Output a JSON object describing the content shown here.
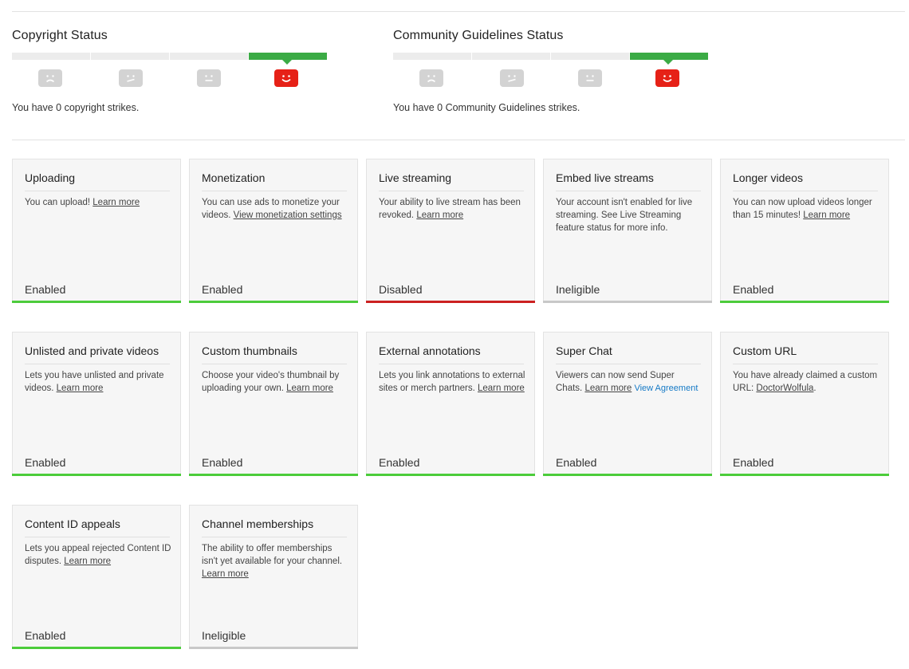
{
  "copyright": {
    "title": "Copyright Status",
    "message": "You have 0 copyright strikes.",
    "strike_levels": 4,
    "current_level": 4
  },
  "community": {
    "title": "Community Guidelines Status",
    "message": "You have 0 Community Guidelines strikes.",
    "strike_levels": 4,
    "current_level": 4
  },
  "colors": {
    "enabled": "#4ccc3b",
    "disabled": "#cc2121",
    "ineligible": "#c8c8c8",
    "active_face": "#e62117",
    "active_bar": "#3bab45"
  },
  "cards": [
    {
      "title": "Uploading",
      "desc": "You can upload!",
      "link": "Learn more",
      "status": "Enabled",
      "state": "enabled"
    },
    {
      "title": "Monetization",
      "desc": "You can use ads to monetize your videos.",
      "link": "View monetization settings",
      "status": "Enabled",
      "state": "enabled"
    },
    {
      "title": "Live streaming",
      "desc": "Your ability to live stream has been revoked.",
      "link": "Learn more",
      "status": "Disabled",
      "state": "disabled"
    },
    {
      "title": "Embed live streams",
      "desc": "Your account isn't enabled for live streaming. See Live Streaming feature status for more info.",
      "link": "",
      "status": "Ineligible",
      "state": "ineligible"
    },
    {
      "title": "Longer videos",
      "desc": "You can now upload videos longer than 15 minutes!",
      "link": "Learn more",
      "status": "Enabled",
      "state": "enabled"
    },
    {
      "title": "Unlisted and private videos",
      "desc": "Lets you have unlisted and private videos.",
      "link": "Learn more",
      "status": "Enabled",
      "state": "enabled"
    },
    {
      "title": "Custom thumbnails",
      "desc": "Choose your video's thumbnail by uploading your own.",
      "link": "Learn more",
      "status": "Enabled",
      "state": "enabled"
    },
    {
      "title": "External annotations",
      "desc": "Lets you link annotations to external sites or merch partners.",
      "link": "Learn more",
      "status": "Enabled",
      "state": "enabled"
    },
    {
      "title": "Super Chat",
      "desc": "Viewers can now send Super Chats.",
      "link": "Learn more",
      "link2": "View Agreement",
      "status": "Enabled",
      "state": "enabled"
    },
    {
      "title": "Custom URL",
      "desc": "You have already claimed a custom URL:",
      "link": "DoctorWolfula",
      "suffix": ".",
      "status": "Enabled",
      "state": "enabled"
    },
    {
      "title": "Content ID appeals",
      "desc": "Lets you appeal rejected Content ID disputes.",
      "link": "Learn more",
      "status": "Enabled",
      "state": "enabled"
    },
    {
      "title": "Channel memberships",
      "desc": "The ability to offer memberships isn't yet available for your channel.",
      "link": "Learn more",
      "status": "Ineligible",
      "state": "ineligible"
    }
  ]
}
